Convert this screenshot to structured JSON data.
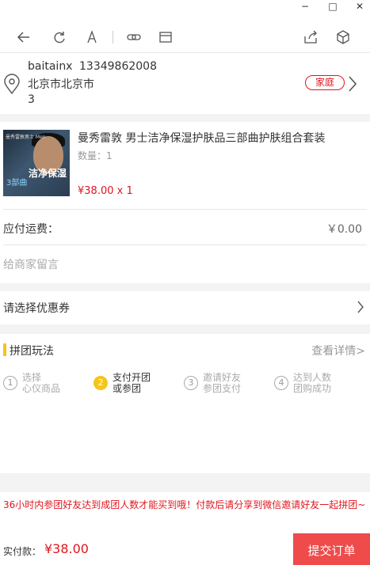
{
  "window": {
    "minimize": "−",
    "maximize": "□",
    "close": "✕"
  },
  "toolbar": {
    "icons": [
      "back-icon",
      "refresh-icon",
      "font-icon",
      "link-icon",
      "window-icon",
      "share-icon",
      "cube-icon"
    ]
  },
  "address": {
    "name": "baitainx",
    "phone": "13349862008",
    "city": "北京市北京市",
    "detail": "3",
    "tag": "家庭"
  },
  "product": {
    "title": "曼秀雷敦 男士洁净保湿护肤品三部曲护肤组合套装",
    "qty": "数量：1",
    "price": "¥38.00 x 1",
    "thumb_brand": "曼秀雷敦男士 Men",
    "thumb_text1": "洁净保湿",
    "thumb_text2": "3部曲"
  },
  "shipping": {
    "label": "应付运费：",
    "value": "￥0.00"
  },
  "message": {
    "placeholder": "给商家留言"
  },
  "coupon": {
    "label": "请选择优惠券"
  },
  "group": {
    "title": "拼团玩法",
    "more": "查看详情>",
    "steps": [
      {
        "num": "1",
        "line1": "选择",
        "line2": "心仪商品"
      },
      {
        "num": "2",
        "line1": "支付开团",
        "line2": "或参团"
      },
      {
        "num": "3",
        "line1": "邀请好友",
        "line2": "参团支付"
      },
      {
        "num": "4",
        "line1": "达到人数",
        "line2": "团购成功"
      }
    ]
  },
  "notice": "36小时内参团好友达到成团人数才能买到哦！付款后请分享到微信邀请好友一起拼团~",
  "footer": {
    "pay_label": "实付款：",
    "pay_value": "¥38.00",
    "submit": "提交订单"
  },
  "colors": {
    "accent": "#e0161f",
    "submit_bg": "#ef4b4b",
    "group_accent": "#f5c518",
    "bg_gray": "#f3f3f3"
  }
}
